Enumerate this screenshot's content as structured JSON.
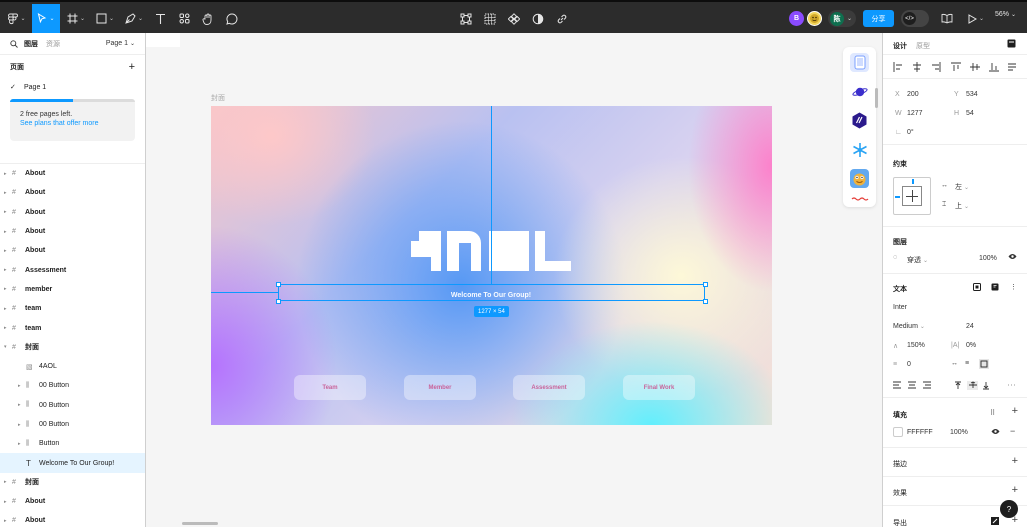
{
  "toolbar": {
    "avatar_b": "B",
    "avatar_user": "陈",
    "share_label": "分享",
    "zoom": "56%"
  },
  "left_panel": {
    "tab_layers": "图层",
    "tab_assets": "资源",
    "page_selector": "Page 1",
    "pages_heading": "页面",
    "current_page": "Page 1",
    "promo_text": "2 free pages left.",
    "promo_link": "See plans that offer more",
    "promo_progress_percent": 50
  },
  "layers": [
    {
      "name": "About",
      "kind": "frame",
      "indent": 0
    },
    {
      "name": "About",
      "kind": "frame",
      "indent": 0
    },
    {
      "name": "About",
      "kind": "frame",
      "indent": 0
    },
    {
      "name": "About",
      "kind": "frame",
      "indent": 0
    },
    {
      "name": "About",
      "kind": "frame",
      "indent": 0
    },
    {
      "name": "Assessment",
      "kind": "frame",
      "indent": 0
    },
    {
      "name": "member",
      "kind": "frame",
      "indent": 0
    },
    {
      "name": "team",
      "kind": "frame",
      "indent": 0
    },
    {
      "name": "team",
      "kind": "frame",
      "indent": 0
    },
    {
      "name": "封面",
      "kind": "frame-open",
      "indent": 0
    },
    {
      "name": "4AOL",
      "kind": "image",
      "indent": 1
    },
    {
      "name": "00 Button",
      "kind": "component",
      "indent": 1
    },
    {
      "name": "00 Button",
      "kind": "component",
      "indent": 1
    },
    {
      "name": "00 Button",
      "kind": "component",
      "indent": 1
    },
    {
      "name": "Button",
      "kind": "component",
      "indent": 1
    },
    {
      "name": "Welcome To Our Group!",
      "kind": "text",
      "indent": 1,
      "selected": true
    },
    {
      "name": "封面",
      "kind": "frame",
      "indent": 0
    },
    {
      "name": "About",
      "kind": "frame",
      "indent": 0
    },
    {
      "name": "About",
      "kind": "frame",
      "indent": 0
    }
  ],
  "canvas": {
    "frame_label": "封面",
    "logo_text": "4AOL",
    "welcome_text": "Welcome To Our Group!",
    "dimension_badge": "1277 × 54",
    "buttons": [
      "Team",
      "Member",
      "Assessment",
      "Final Work"
    ]
  },
  "right_panel": {
    "tab_design": "设计",
    "tab_prototype": "原型",
    "x_label": "X",
    "x_value": "200",
    "y_label": "Y",
    "y_value": "534",
    "w_label": "W",
    "w_value": "1277",
    "h_label": "H",
    "h_value": "54",
    "rotation": "0°",
    "constraints_title": "约束",
    "constraint_h": "左",
    "constraint_v": "上",
    "layer_title": "图层",
    "blend_mode": "穿透",
    "opacity": "100%",
    "text_title": "文本",
    "font_family": "Inter",
    "font_weight": "Medium",
    "font_size": "24",
    "line_height": "150%",
    "letter_spacing": "0%",
    "paragraph_spacing": "0",
    "fill_title": "填充",
    "fill_hex": "FFFFFF",
    "fill_opacity": "100%",
    "stroke_title": "描边",
    "effects_title": "效果",
    "export_title": "导出",
    "help": "?"
  },
  "colors": {
    "accent": "#0d99ff",
    "toolbar_bg": "#2c2c2c",
    "button_text": "#c9649b"
  }
}
